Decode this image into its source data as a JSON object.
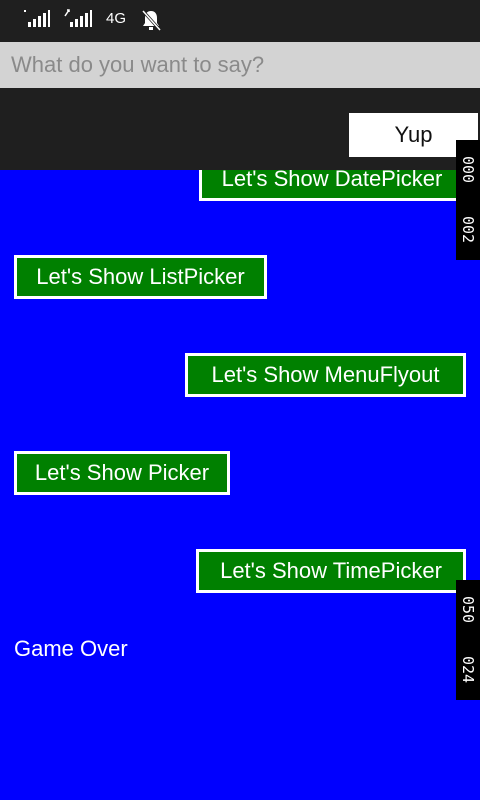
{
  "status": {
    "network": "4G"
  },
  "input": {
    "placeholder": "What do you want to say?",
    "value": ""
  },
  "yup_label": "Yup",
  "buttons": [
    "Let's Show DatePicker",
    "Let's Show ListPicker",
    "Let's Show MenuFlyout",
    "Let's Show Picker",
    "Let's Show TimePicker"
  ],
  "game_over": "Game Over",
  "counters": {
    "top": [
      "000",
      "002"
    ],
    "bottom": [
      "050",
      "024"
    ]
  },
  "colors": {
    "background": "#0000FF",
    "button": "#008000",
    "chrome": "#1F1F1F",
    "input": "#D3D3D3"
  }
}
